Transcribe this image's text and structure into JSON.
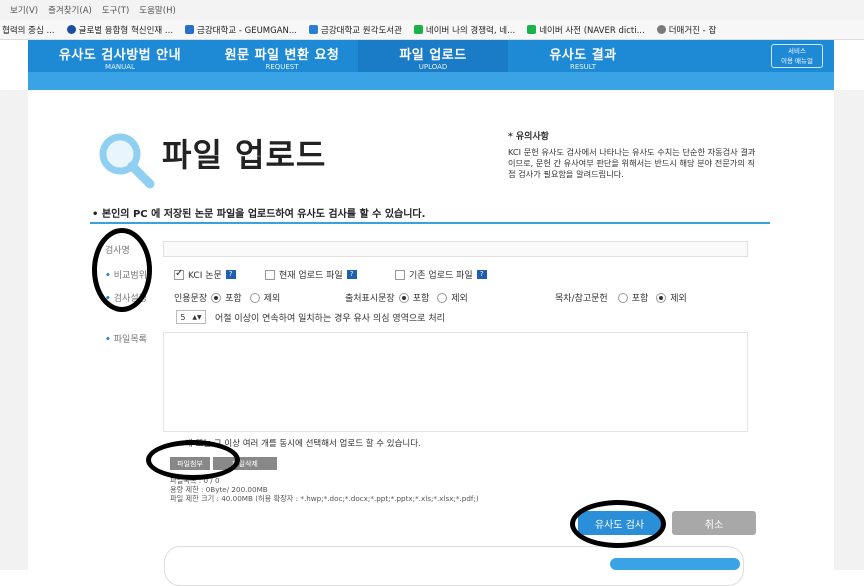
{
  "browser": {
    "menu": [
      "보기(V)",
      "즐겨찾기(A)",
      "도구(T)",
      "도움말(H)"
    ],
    "bookmarks": [
      {
        "label": "협력의 중심 ...",
        "color": "#ffffff"
      },
      {
        "label": "글로벌 융합형 혁신인재 ...",
        "color": "#1c4fa0"
      },
      {
        "label": "금강대학교 - GEUMGAN...",
        "color": "#2a6fc9"
      },
      {
        "label": "금강대학교 원각도서관",
        "color": "#2a7fd0"
      },
      {
        "label": "네이버 나의 경쟁력, 네...",
        "color": "#19b34a"
      },
      {
        "label": "네이버 사전 (NAVER dicti...",
        "color": "#19b34a"
      },
      {
        "label": "더매거진 - 잡",
        "color": "#7a7a7a"
      }
    ]
  },
  "header": {
    "tabs": [
      {
        "title": "유사도 검사방법 안내",
        "sub": "MANUAL"
      },
      {
        "title": "원문 파일 변환 요청",
        "sub": "REQUEST"
      },
      {
        "title": "파일 업로드",
        "sub": "UPLOAD"
      },
      {
        "title": "유사도 결과",
        "sub": "RESULT"
      }
    ],
    "service_line1": "서비스",
    "service_line2": "이용 매뉴얼"
  },
  "page": {
    "title": "파일 업로드",
    "notice_title": "* 유의사항",
    "notice_body": "KCI 문헌 유사도 검사에서 나타나는 유사도 수치는 단순한 자동검사 결과이므로, 문헌 간 유사여부 판단을 위해서는 반드시 해당 분야 전문가의 직접 검사가 필요함을 알려드립니다.",
    "intro": "• 본인의 PC 에 저장된 논문 파일을 업로드하여 유사도 검사를 할 수 있습니다."
  },
  "form": {
    "label_title": "검사명",
    "label_scope": "비교범위",
    "label_settings": "검사설정",
    "label_files": "파일목록",
    "scope_kci": "KCI 논문",
    "scope_current": "현재 업로드 파일",
    "scope_existing": "기존 업로드 파일",
    "quote_label": "인용문장",
    "source_label": "출처표시문장",
    "ref_label": "목차/참고문헌",
    "include": "포함",
    "exclude": "제외",
    "word_count": "5",
    "word_rule": "어절 이상이 연속하여 일치하는 경우 유사 의심 영역으로 처리",
    "multi_note": "개 또는 그 이상 여러 개를 동시에 선택해서 업로드 할 수 있습니다.",
    "attach_btn": "파일첨부",
    "delete_btn": "파일삭제",
    "file_count_line": "파일목록 : 0 / 0",
    "capacity_line": "용량 제한 : 0Byte/ 200.00MB",
    "size_limit_line": "파일 제한 크기 : 40.00MB (허용 확장자 : *.hwp;*.doc;*.docx;*.ppt;*.pptx;*.xls;*.xlsx;*.pdf;)"
  },
  "actions": {
    "check": "유사도 검사",
    "cancel": "취소"
  },
  "colors": {
    "brand": "#1e8ad6",
    "check_button": "#2a8fd8",
    "cancel_button": "#a8a8a8"
  }
}
